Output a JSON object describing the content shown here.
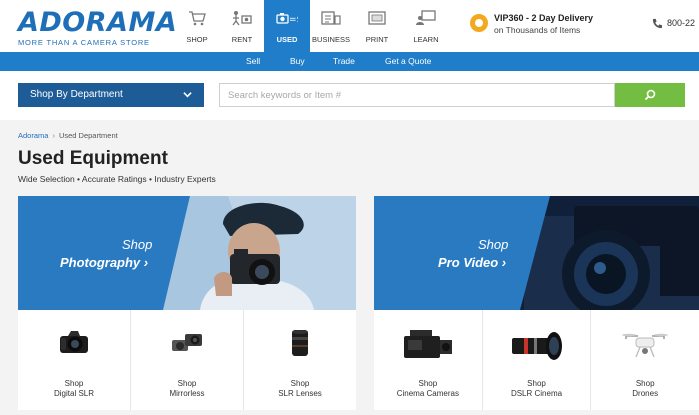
{
  "brand": {
    "name": "ADORAMA",
    "tagline": "MORE THAN A CAMERA STORE",
    "color": "#1f6fb8"
  },
  "nav": [
    {
      "label": "SHOP",
      "icon": "cart-icon"
    },
    {
      "label": "RENT",
      "icon": "rent-icon"
    },
    {
      "label": "USED",
      "icon": "used-camera-icon",
      "active": true
    },
    {
      "label": "BUSINESS",
      "icon": "business-icon"
    },
    {
      "label": "PRINT",
      "icon": "print-icon"
    },
    {
      "label": "LEARN",
      "icon": "learn-icon"
    }
  ],
  "promo": {
    "title": "VIP360 - 2 Day Delivery",
    "subtitle": "on Thousands of Items"
  },
  "phone": {
    "number": "800-22",
    "icon": "phone-icon"
  },
  "subnav": [
    "Sell",
    "Buy",
    "Trade",
    "Get a Quote"
  ],
  "search": {
    "department_label": "Shop By Department",
    "placeholder": "Search keywords or Item #",
    "value": ""
  },
  "breadcrumb": {
    "home": "Adorama",
    "separator": "›",
    "current": "Used Department"
  },
  "page": {
    "title": "Used Equipment",
    "subtitle": "Wide Selection • Accurate Ratings • Industry Experts"
  },
  "cards": [
    {
      "hero_shop": "Shop",
      "hero_category": "Photography ›",
      "tiles": [
        {
          "shop": "Shop",
          "label": "Digital SLR",
          "icon": "dslr-camera-icon"
        },
        {
          "shop": "Shop",
          "label": "Mirrorless",
          "icon": "mirrorless-camera-icon"
        },
        {
          "shop": "Shop",
          "label": "SLR Lenses",
          "icon": "lens-icon"
        }
      ]
    },
    {
      "hero_shop": "Shop",
      "hero_category": "Pro Video ›",
      "tiles": [
        {
          "shop": "Shop",
          "label": "Cinema Cameras",
          "icon": "cinema-camera-icon"
        },
        {
          "shop": "Shop",
          "label": "DSLR Cinema",
          "icon": "cinema-lens-icon"
        },
        {
          "shop": "Shop",
          "label": "Drones",
          "icon": "drone-icon"
        }
      ]
    }
  ],
  "colors": {
    "primary": "#1f7dc9",
    "dark": "#1e5c98",
    "search_button": "#74bd43",
    "vip": "#f4a81d"
  }
}
